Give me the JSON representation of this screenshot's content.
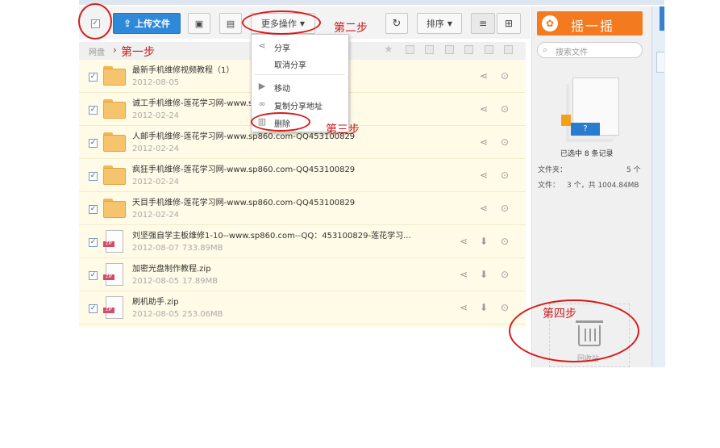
{
  "toolbar": {
    "select_all_checked": "✓",
    "upload_label": "上传文件",
    "more_ops_label": "更多操作",
    "sort_label": "排序"
  },
  "breadcrumb": {
    "root": "网盘"
  },
  "menu": {
    "items": [
      {
        "label": "分享",
        "icon": "share-icon"
      },
      {
        "label": "取消分享",
        "icon": ""
      },
      {
        "label": "移动",
        "icon": "move-icon"
      },
      {
        "label": "复制分享地址",
        "icon": "link-icon"
      },
      {
        "label": "删除",
        "icon": "trash-icon"
      }
    ]
  },
  "files": [
    {
      "name": "最新手机维修视频教程（1）",
      "date": "2012-08-05",
      "size": "",
      "type": "folder"
    },
    {
      "name": "诚工手机维修-莲花学习网-www.sp",
      "date": "2012-02-24",
      "size": "",
      "type": "folder"
    },
    {
      "name": "人邮手机维修-莲花学习网-www.sp860.com-QQ453100829",
      "date": "2012-02-24",
      "size": "",
      "type": "folder"
    },
    {
      "name": "疯狂手机维修-莲花学习网-www.sp860.com-QQ453100829",
      "date": "2012-02-24",
      "size": "",
      "type": "folder"
    },
    {
      "name": "天目手机维修-莲花学习网-www.sp860.com-QQ453100829",
      "date": "2012-02-24",
      "size": "",
      "type": "folder"
    },
    {
      "name": "刘坚强自学主板维修1-10--www.sp860.com--QQ：453100829-莲花学习...",
      "date": "2012-08-07",
      "size": "733.89MB",
      "type": "zip"
    },
    {
      "name": "加密光盘制作教程.zip",
      "date": "2012-08-05",
      "size": "17.89MB",
      "type": "zip"
    },
    {
      "name": "刷机助手.zip",
      "date": "2012-08-05",
      "size": "253.06MB",
      "type": "zip"
    }
  ],
  "right_panel": {
    "shake_label": "摇一摇",
    "search_placeholder": "搜索文件",
    "selected_text": "已选中 8 条记录",
    "folder_label": "文件夹：",
    "folder_count": "5 个",
    "file_label": "文件：",
    "file_count": "3 个，共 1004.84MB",
    "recycle_label": "回收站",
    "preview_badge": "?"
  },
  "annotations": {
    "step1": "第一步",
    "step2": "第二步",
    "step3": "第三步",
    "step4": "第四步"
  },
  "colors": {
    "accent_blue": "#2e8ad8",
    "orange": "#f37a1f",
    "annotation_red": "#d81b1b",
    "list_bg": "#fffbe6"
  }
}
